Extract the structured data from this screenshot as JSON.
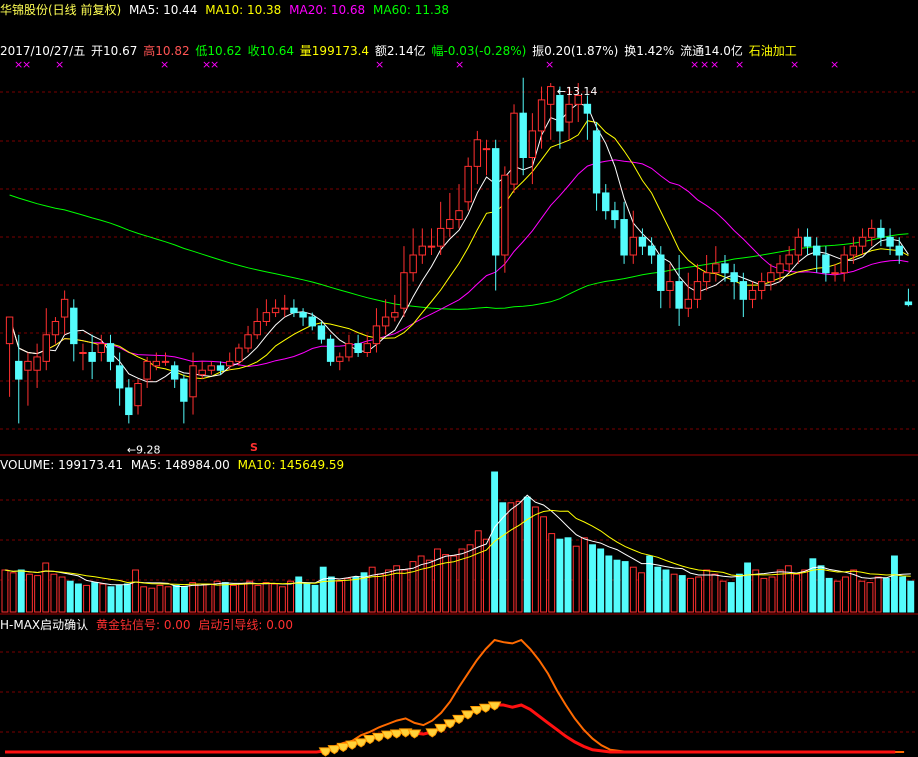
{
  "title_bar": {
    "name": "华锦股份(日线 前复权)",
    "ma5": "MA5: 10.44",
    "ma10": "MA10: 10.38",
    "ma20": "MA20: 10.68",
    "ma60": "MA60: 11.38"
  },
  "quote_bar": {
    "date": "2017/10/27/五",
    "open": "开10.67",
    "high": "高10.82",
    "low": "低10.62",
    "close": "收10.64",
    "vol": "量199173.4",
    "amount": "额2.14亿",
    "change": "幅-0.03(-0.28%)",
    "amplitude": "振0.20(1.87%)",
    "turnover": "换1.42%",
    "float": "流通14.0亿",
    "industry": "石油加工"
  },
  "volume_bar": {
    "volume": "VOLUME: 199173.41",
    "ma5": "MA5: 148984.00",
    "ma10": "MA10: 145649.59"
  },
  "indicator_bar": {
    "name": "H-MAX启动确认",
    "gold": "黄金钻信号: 0.00",
    "guide": "启动引导线: 0.00"
  },
  "colors": {
    "up": "#ff3030",
    "down": "#54fcfc",
    "ma5": "#ffffff",
    "ma10": "#ffff00",
    "ma20": "#ff00ff",
    "ma60": "#00ff00",
    "grid": "#7a0000"
  },
  "chart_data": {
    "type": "candlestick",
    "annotations": {
      "high_label": "13.14",
      "low_label": "9.28",
      "s_marker": "S"
    },
    "price_range": [
      9.0,
      13.4
    ],
    "candles": [
      [
        10.2,
        10.5,
        10.5,
        9.6
      ],
      [
        10.0,
        9.8,
        10.3,
        9.3
      ],
      [
        9.9,
        10.0,
        10.1,
        9.5
      ],
      [
        9.9,
        10.05,
        10.2,
        9.7
      ],
      [
        10.0,
        10.3,
        10.6,
        9.9
      ],
      [
        10.3,
        10.45,
        10.5,
        10.2
      ],
      [
        10.5,
        10.7,
        10.8,
        10.3
      ],
      [
        10.6,
        10.2,
        10.7,
        10.0
      ],
      [
        10.1,
        10.1,
        10.2,
        9.9
      ],
      [
        10.1,
        10.0,
        10.3,
        9.8
      ],
      [
        10.1,
        10.2,
        10.3,
        10.0
      ],
      [
        10.2,
        10.0,
        10.3,
        9.9
      ],
      [
        9.95,
        9.7,
        10.1,
        9.5
      ],
      [
        9.7,
        9.4,
        9.8,
        9.3
      ],
      [
        9.5,
        9.75,
        9.8,
        9.4
      ],
      [
        9.8,
        10.0,
        10.05,
        9.7
      ],
      [
        9.95,
        10.0,
        10.1,
        9.9
      ],
      [
        10.0,
        10.0,
        10.1,
        9.95
      ],
      [
        9.95,
        9.8,
        10.0,
        9.7
      ],
      [
        9.8,
        9.55,
        9.85,
        9.3
      ],
      [
        9.6,
        9.95,
        10.1,
        9.4
      ],
      [
        9.85,
        9.9,
        10.0,
        9.8
      ],
      [
        9.9,
        9.95,
        10.0,
        9.85
      ],
      [
        9.95,
        9.9,
        10.0,
        9.85
      ],
      [
        9.95,
        10.0,
        10.1,
        9.9
      ],
      [
        10.0,
        10.15,
        10.2,
        9.95
      ],
      [
        10.15,
        10.3,
        10.4,
        10.1
      ],
      [
        10.3,
        10.45,
        10.6,
        10.25
      ],
      [
        10.45,
        10.55,
        10.7,
        10.4
      ],
      [
        10.55,
        10.6,
        10.7,
        10.5
      ],
      [
        10.6,
        10.6,
        10.75,
        10.5
      ],
      [
        10.6,
        10.55,
        10.7,
        10.5
      ],
      [
        10.55,
        10.5,
        10.6,
        10.4
      ],
      [
        10.5,
        10.4,
        10.55,
        10.35
      ],
      [
        10.4,
        10.25,
        10.45,
        10.2
      ],
      [
        10.25,
        10.0,
        10.3,
        9.95
      ],
      [
        10.0,
        10.05,
        10.1,
        9.9
      ],
      [
        10.05,
        10.2,
        10.3,
        10.0
      ],
      [
        10.2,
        10.1,
        10.3,
        10.05
      ],
      [
        10.1,
        10.2,
        10.3,
        10.05
      ],
      [
        10.2,
        10.4,
        10.6,
        10.1
      ],
      [
        10.4,
        10.5,
        10.7,
        10.3
      ],
      [
        10.5,
        10.55,
        10.75,
        10.45
      ],
      [
        10.6,
        11.0,
        11.3,
        10.5
      ],
      [
        11.0,
        11.2,
        11.5,
        10.9
      ],
      [
        11.2,
        11.3,
        11.5,
        11.1
      ],
      [
        11.3,
        11.3,
        11.5,
        11.2
      ],
      [
        11.3,
        11.5,
        11.8,
        11.2
      ],
      [
        11.5,
        11.6,
        11.9,
        11.4
      ],
      [
        11.6,
        11.7,
        12.0,
        11.5
      ],
      [
        11.8,
        12.2,
        12.3,
        11.7
      ],
      [
        12.2,
        12.5,
        12.6,
        12.0
      ],
      [
        12.4,
        12.4,
        12.5,
        12.1
      ],
      [
        12.4,
        11.2,
        12.5,
        10.8
      ],
      [
        11.2,
        12.1,
        12.2,
        11.0
      ],
      [
        12.0,
        12.8,
        12.9,
        11.9
      ],
      [
        12.8,
        12.3,
        13.2,
        12.1
      ],
      [
        12.3,
        12.6,
        12.8,
        12.0
      ],
      [
        12.6,
        12.95,
        13.1,
        12.4
      ],
      [
        12.9,
        13.1,
        13.14,
        12.5
      ],
      [
        13.0,
        12.6,
        13.1,
        12.4
      ],
      [
        12.7,
        12.9,
        13.1,
        12.5
      ],
      [
        12.9,
        13.0,
        13.14,
        12.7
      ],
      [
        12.9,
        12.8,
        13.0,
        12.5
      ],
      [
        12.6,
        11.9,
        12.7,
        11.7
      ],
      [
        11.9,
        11.7,
        12.0,
        11.6
      ],
      [
        11.7,
        11.6,
        11.8,
        11.5
      ],
      [
        11.6,
        11.2,
        11.8,
        11.1
      ],
      [
        11.2,
        11.4,
        11.7,
        11.1
      ],
      [
        11.4,
        11.3,
        11.5,
        11.2
      ],
      [
        11.3,
        11.2,
        11.4,
        11.1
      ],
      [
        11.2,
        10.8,
        11.3,
        10.6
      ],
      [
        10.8,
        10.9,
        11.1,
        10.6
      ],
      [
        10.9,
        10.6,
        11.2,
        10.4
      ],
      [
        10.6,
        10.7,
        11.0,
        10.5
      ],
      [
        10.7,
        10.9,
        11.1,
        10.6
      ],
      [
        10.9,
        11.0,
        11.2,
        10.8
      ],
      [
        11.0,
        11.1,
        11.3,
        10.9
      ],
      [
        11.1,
        11.0,
        11.2,
        10.9
      ],
      [
        11.0,
        10.9,
        11.1,
        10.7
      ],
      [
        10.9,
        10.7,
        11.0,
        10.5
      ],
      [
        10.7,
        10.8,
        10.9,
        10.6
      ],
      [
        10.8,
        10.9,
        11.0,
        10.7
      ],
      [
        10.9,
        11.0,
        11.1,
        10.8
      ],
      [
        11.0,
        11.1,
        11.2,
        10.9
      ],
      [
        11.1,
        11.2,
        11.3,
        11.0
      ],
      [
        11.2,
        11.4,
        11.5,
        11.1
      ],
      [
        11.4,
        11.3,
        11.5,
        11.2
      ],
      [
        11.3,
        11.2,
        11.4,
        11.0
      ],
      [
        11.2,
        11.0,
        11.3,
        10.9
      ],
      [
        11.0,
        11.0,
        11.1,
        10.9
      ],
      [
        11.0,
        11.2,
        11.3,
        10.9
      ],
      [
        11.2,
        11.3,
        11.4,
        11.1
      ],
      [
        11.3,
        11.4,
        11.5,
        11.2
      ],
      [
        11.4,
        11.5,
        11.6,
        11.3
      ],
      [
        11.5,
        11.4,
        11.6,
        11.3
      ],
      [
        11.4,
        11.3,
        11.5,
        11.2
      ],
      [
        11.3,
        11.2,
        11.4,
        11.1
      ],
      [
        10.67,
        10.64,
        10.82,
        10.62
      ]
    ],
    "ma60_start": 11.9,
    "volumes": [
      0.3,
      0.28,
      0.3,
      0.27,
      0.26,
      0.35,
      0.27,
      0.25,
      0.22,
      0.2,
      0.19,
      0.21,
      0.2,
      0.18,
      0.19,
      0.2,
      0.3,
      0.18,
      0.17,
      0.19,
      0.18,
      0.19,
      0.18,
      0.21,
      0.2,
      0.2,
      0.22,
      0.21,
      0.19,
      0.2,
      0.22,
      0.19,
      0.21,
      0.2,
      0.18,
      0.22,
      0.25,
      0.2,
      0.19,
      0.32,
      0.25,
      0.22,
      0.24,
      0.25,
      0.28,
      0.32,
      0.27,
      0.3,
      0.33,
      0.3,
      0.36,
      0.4,
      0.37,
      0.45,
      0.41,
      0.4,
      0.45,
      0.48,
      0.58,
      0.52,
      1.0,
      0.78,
      0.78,
      0.79,
      0.82,
      0.75,
      0.68,
      0.56,
      0.52,
      0.53,
      0.47,
      0.53,
      0.48,
      0.45,
      0.4,
      0.37,
      0.36,
      0.32,
      0.28,
      0.4,
      0.32,
      0.3,
      0.27,
      0.26,
      0.24,
      0.25,
      0.3,
      0.27,
      0.22,
      0.21,
      0.27,
      0.35,
      0.3,
      0.24,
      0.25,
      0.3,
      0.33,
      0.27,
      0.3,
      0.38,
      0.33,
      0.24,
      0.22,
      0.25,
      0.3,
      0.22,
      0.21,
      0.25,
      0.24,
      0.4,
      0.25,
      0.22
    ],
    "indicator": {
      "orange": [
        0,
        0,
        0,
        0,
        0,
        0,
        0,
        0,
        0,
        0,
        0,
        0,
        0,
        0,
        0,
        0,
        0,
        0,
        0,
        0,
        0,
        0,
        0,
        0,
        0,
        0,
        0,
        0,
        0,
        0,
        0,
        0,
        0,
        0,
        0,
        0,
        0.02,
        0.05,
        0.08,
        0.1,
        0.15,
        0.18,
        0.22,
        0.25,
        0.28,
        0.3,
        0.26,
        0.24,
        0.28,
        0.35,
        0.45,
        0.58,
        0.7,
        0.82,
        0.92,
        1.0,
        0.98,
        0.97,
        1.0,
        0.92,
        0.82,
        0.7,
        0.55,
        0.42,
        0.3,
        0.2,
        0.12,
        0.06,
        0.02,
        0.01,
        0,
        0,
        0,
        0,
        0,
        0,
        0,
        0,
        0,
        0,
        0,
        0,
        0,
        0,
        0,
        0,
        0,
        0,
        0,
        0,
        0,
        0,
        0,
        0,
        0,
        0,
        0,
        0,
        0,
        0,
        0,
        0
      ],
      "red": [
        0,
        0,
        0,
        0,
        0,
        0,
        0,
        0,
        0,
        0,
        0,
        0,
        0,
        0,
        0,
        0,
        0,
        0,
        0,
        0,
        0,
        0,
        0,
        0,
        0,
        0,
        0,
        0,
        0,
        0,
        0,
        0,
        0,
        0,
        0,
        0,
        0.01,
        0.03,
        0.05,
        0.07,
        0.09,
        0.12,
        0.14,
        0.16,
        0.17,
        0.18,
        0.17,
        0.16,
        0.18,
        0.22,
        0.26,
        0.3,
        0.34,
        0.38,
        0.4,
        0.42,
        0.42,
        0.4,
        0.42,
        0.38,
        0.32,
        0.26,
        0.2,
        0.14,
        0.09,
        0.05,
        0.02,
        0.01,
        0,
        0,
        0,
        0,
        0,
        0,
        0,
        0,
        0,
        0,
        0,
        0,
        0,
        0,
        0,
        0,
        0,
        0,
        0,
        0,
        0,
        0,
        0,
        0,
        0,
        0,
        0,
        0,
        0,
        0,
        0,
        0,
        0
      ],
      "diamonds": [
        36,
        37,
        38,
        39,
        40,
        41,
        42,
        43,
        44,
        45,
        46,
        48,
        49,
        50,
        51,
        52,
        53,
        54,
        55
      ]
    }
  }
}
